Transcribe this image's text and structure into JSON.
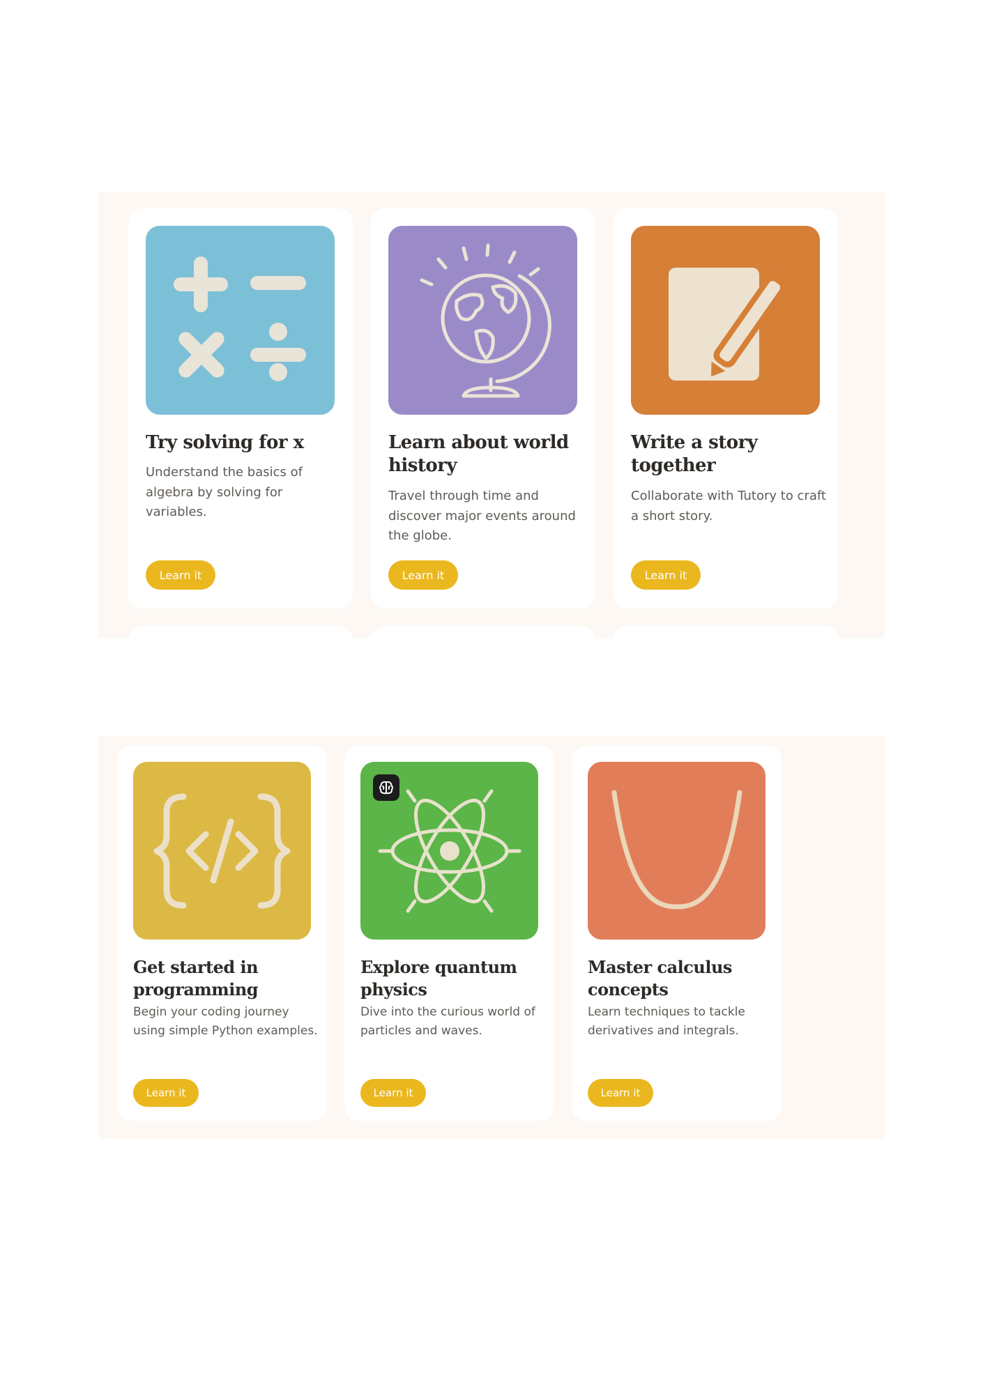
{
  "theme": {
    "panel_bg": "#fdf8f3",
    "card_bg": "#ffffff",
    "button_bg": "#eab71e",
    "button_text": "#ffffff",
    "title_color": "#2d2a27",
    "desc_color": "#5f5a55"
  },
  "section_one": {
    "cards": [
      {
        "icon": "math-operators-icon",
        "tile_color": "#7cc0d7",
        "title": "Try solving for x",
        "description": "Understand the basics of algebra by solving for variables.",
        "button_label": "Learn it"
      },
      {
        "icon": "globe-icon",
        "tile_color": "#9a8bc8",
        "title": "Learn about world history",
        "description": "Travel through time and discover major events around the globe.",
        "button_label": "Learn it"
      },
      {
        "icon": "paper-pencil-icon",
        "tile_color": "#d67f37",
        "title": "Write a story together",
        "description": "Collaborate with Tutory to craft a short story.",
        "button_label": "Learn it"
      }
    ]
  },
  "section_two": {
    "cards": [
      {
        "icon": "code-brackets-icon",
        "tile_color": "#dcb944",
        "title": "Get started in programming",
        "description": "Begin your coding journey using simple Python examples.",
        "button_label": "Learn it"
      },
      {
        "icon": "atom-icon",
        "badge_icon": "brain-icon",
        "tile_color": "#5bb548",
        "title": "Explore quantum physics",
        "description": "Dive into the curious world of particles and waves.",
        "button_label": "Learn it"
      },
      {
        "icon": "parabola-curve-icon",
        "tile_color": "#e27d5a",
        "title": "Master calculus concepts",
        "description": "Learn techniques to tackle derivatives and integrals.",
        "button_label": "Learn it"
      }
    ]
  }
}
